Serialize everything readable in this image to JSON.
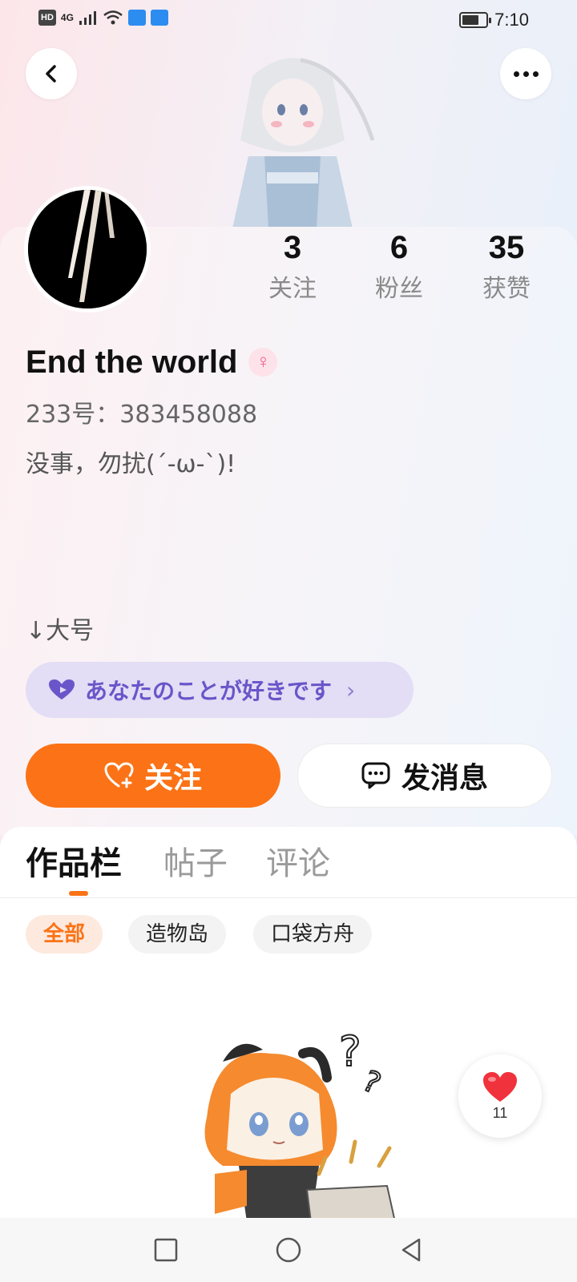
{
  "status_bar": {
    "network_label": "HD",
    "signal_label": "4G",
    "time": "7:10",
    "icons": [
      "signal-icon",
      "wifi-icon",
      "battery-icon"
    ]
  },
  "header": {
    "back_icon": "chevron-left-icon",
    "more_icon": "more-dots-icon"
  },
  "profile": {
    "username": "End the world",
    "gender_symbol": "♀",
    "id_line": "233号：383458088",
    "bio": "没事，勿扰(´-ω-`)!",
    "bio_second": "↓大号",
    "tag_text": "あなたのことが好きです",
    "tag_chevron": "›",
    "stats": [
      {
        "value": "3",
        "label": "关注"
      },
      {
        "value": "6",
        "label": "粉丝"
      },
      {
        "value": "35",
        "label": "获赞"
      }
    ]
  },
  "actions": {
    "follow_label": "关注",
    "message_label": "发消息"
  },
  "tabs": [
    {
      "label": "作品栏",
      "active": true
    },
    {
      "label": "帖子",
      "active": false
    },
    {
      "label": "评论",
      "active": false
    }
  ],
  "filters": [
    {
      "label": "全部",
      "active": true
    },
    {
      "label": "造物岛",
      "active": false
    },
    {
      "label": "口袋方舟",
      "active": false
    }
  ],
  "like_fab": {
    "count": "11"
  },
  "colors": {
    "accent": "#fb7316",
    "tag_text": "#6a55c9",
    "tag_bg": "#e3ddf5",
    "heart": "#f0323c"
  }
}
